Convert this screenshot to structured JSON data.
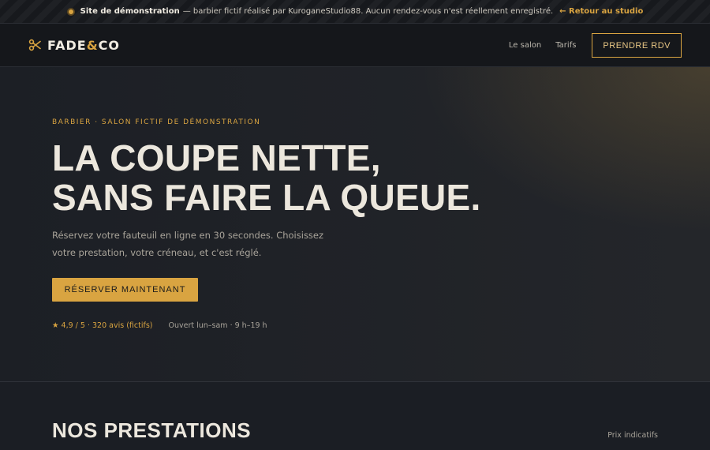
{
  "banner": {
    "label": "Site de démonstration",
    "text": "— barbier fictif réalisé par KuroganeStudio88. Aucun rendez-vous n'est réellement enregistré.",
    "back_link": "← Retour au studio"
  },
  "header": {
    "logo_left": "FADE",
    "logo_amp": "&",
    "logo_right": "CO",
    "nav": {
      "salon": "Le salon",
      "tarifs": "Tarifs",
      "cta": "PRENDRE RDV"
    }
  },
  "hero": {
    "eyebrow": "BARBIER · SALON FICTIF DE DÉMONSTRATION",
    "headline_line1": "LA COUPE NETTE,",
    "headline_line2": "SANS FAIRE LA QUEUE.",
    "lede_line1": "Réservez votre fauteuil en ligne en 30 secondes. Choisissez",
    "lede_line2": "votre prestation, votre créneau, et c'est réglé.",
    "button": "RÉSERVER MAINTENANT",
    "rating": "★ 4,9 / 5 · 320 avis (fictifs)",
    "hours": "Ouvert lun–sam · 9 h–19 h"
  },
  "services": {
    "title": "NOS PRESTATIONS",
    "note": "Prix indicatifs"
  },
  "colors": {
    "accent": "#d9a441",
    "background": "#1b1e24",
    "text": "#ece7dd"
  },
  "icons": {
    "logo": "scissors-icon",
    "banner": "demo-dot-icon"
  }
}
